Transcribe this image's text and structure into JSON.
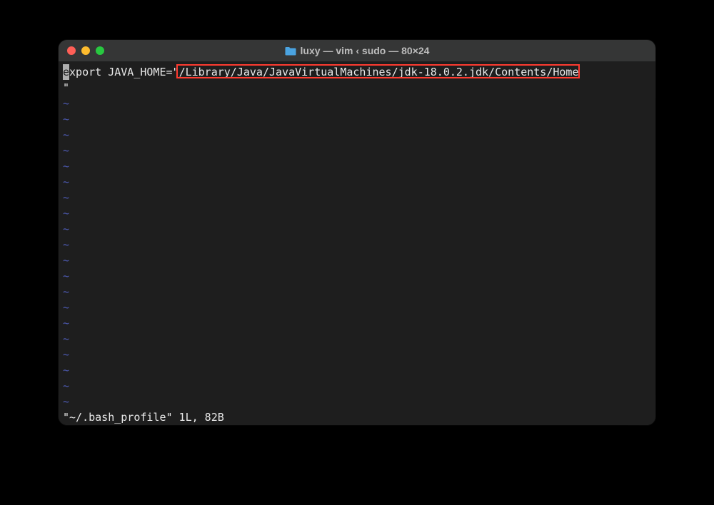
{
  "title": "luxy — vim ‹ sudo — 80×24",
  "icon_name": "folder-icon",
  "editor": {
    "cursor_char": "e",
    "line1_after_cursor": "xport JAVA_HOME=\"",
    "line1_highlighted": "/Library/Java/JavaVirtualMachines/jdk-18.0.2.jdk/Contents/Home",
    "line2": "\"",
    "tilde": "~",
    "tilde_count": 20,
    "status": "\"~/.bash_profile\" 1L, 82B"
  },
  "colors": {
    "highlight_border": "#ff3b30",
    "tilde": "#4e5bb5",
    "bg": "#1e1e1e",
    "titlebar": "#353636"
  }
}
